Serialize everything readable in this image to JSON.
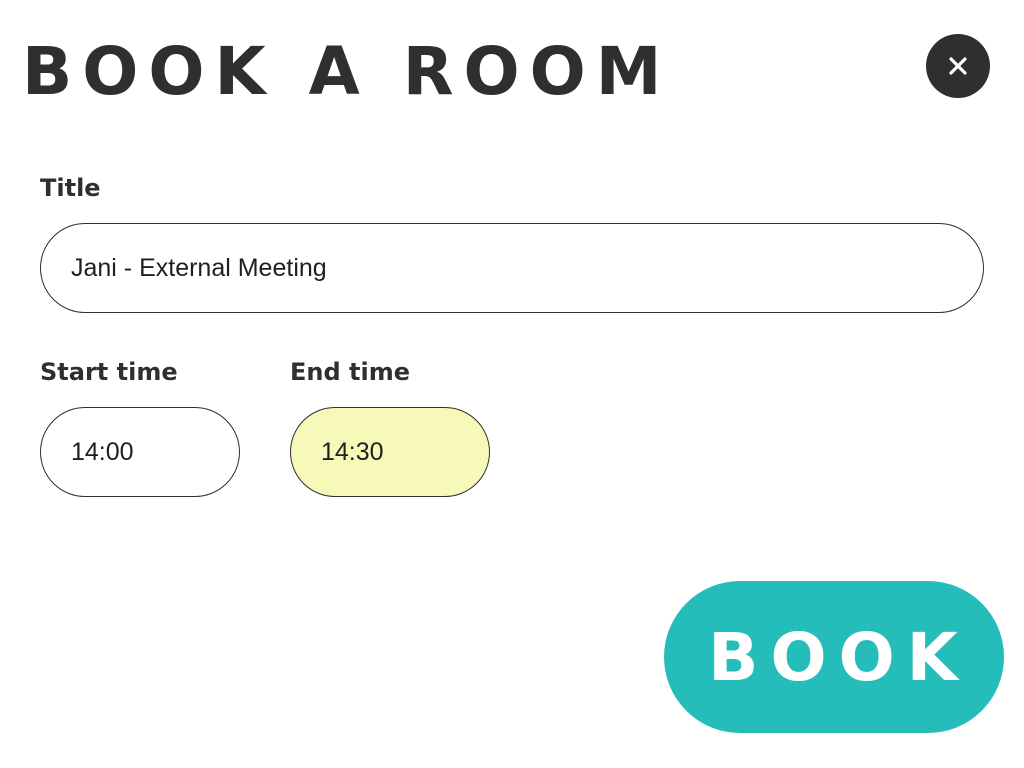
{
  "header": {
    "title": "BOOK A ROOM",
    "close_icon": "close-icon"
  },
  "form": {
    "title_label": "Title",
    "title_value": "Jani - External Meeting",
    "start_label": "Start time",
    "start_value": "14:00",
    "end_label": "End time",
    "end_value": "14:30"
  },
  "actions": {
    "book_label": "BOOK"
  },
  "colors": {
    "text": "#2f2f2f",
    "accent": "#24bdb9",
    "highlight_field": "#f7f9b9",
    "background": "#ffffff"
  }
}
